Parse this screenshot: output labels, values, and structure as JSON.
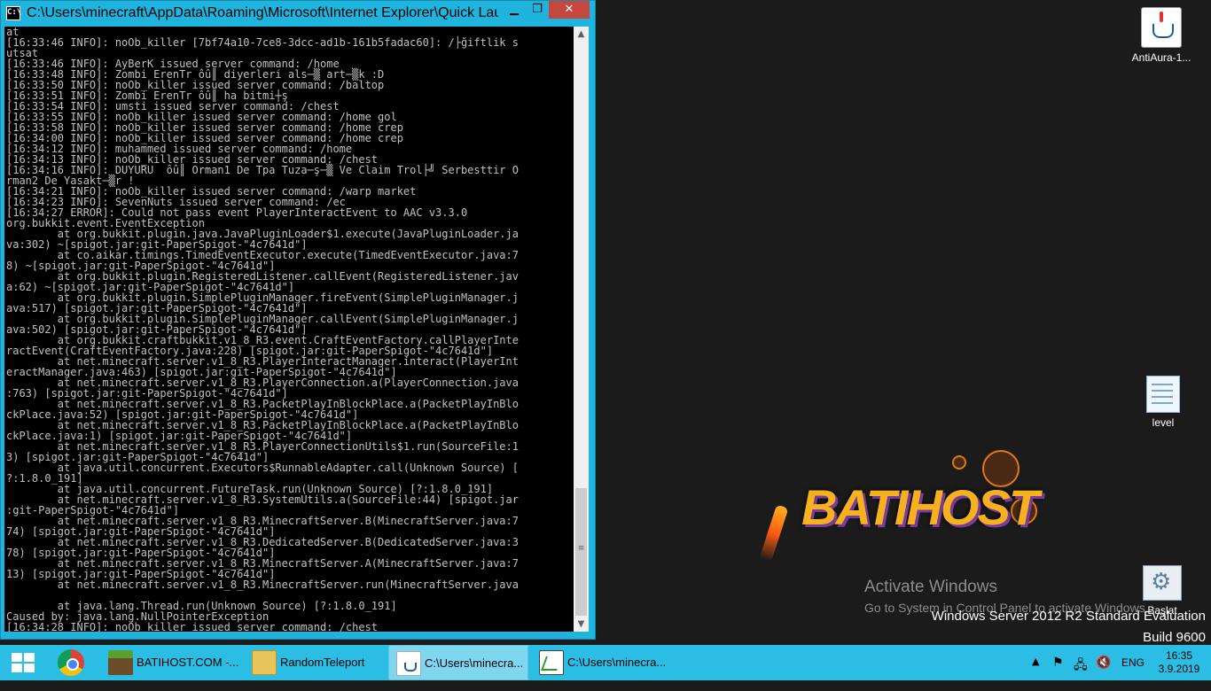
{
  "console": {
    "title": "C:\\Users\\minecraft\\AppData\\Roaming\\Microsoft\\Internet Explorer\\Quick Launc...",
    "controls": {
      "minimize": "▁",
      "maximize": "❐",
      "close": "✕"
    },
    "lines": [
      "at",
      "[16:33:46 INFO]: noOb_killer [7bf74a10-7ce8-3dcc-ad1b-161b5fadac60]: /├ğiftlik s",
      "utsat",
      "[16:33:46 INFO]: AyBerK issued server command: /home",
      "[16:33:48 INFO]: Zombi ErenTr ôû║ diyerleri als─▒ art─▒k :D",
      "[16:33:50 INFO]: noOb_killer issued server command: /baltop",
      "[16:33:51 INFO]: Zombi ErenTr ôû║ ha bitmi┼ş",
      "[16:33:54 INFO]: umsti issued server command: /chest",
      "[16:33:55 INFO]: noOb_killer issued server command: /home gol",
      "[16:33:58 INFO]: noOb_killer issued server command: /home crep",
      "[16:34:00 INFO]: noOb_killer issued server command: /home crep",
      "[16:34:12 INFO]: muhammed issued server command: /home",
      "[16:34:13 INFO]: noOb_killer issued server command: /chest",
      "[16:34:16 INFO]: DUYURU  ôû║ Orman1 De Tpa Tuza─ş─▒ Ve Claim Trol├╝ Serbesttir O",
      "rman2 De Yasakt─▒r !",
      "[16:34:21 INFO]: noOb_killer issued server command: /warp market",
      "[16:34:23 INFO]: SevenNuts issued server command: /ec",
      "[16:34:27 ERROR]: Could not pass event PlayerInteractEvent to AAC v3.3.0",
      "org.bukkit.event.EventException",
      "        at org.bukkit.plugin.java.JavaPluginLoader$1.execute(JavaPluginLoader.ja",
      "va:302) ~[spigot.jar:git-PaperSpigot-\"4c7641d\"]",
      "        at co.aikar.timings.TimedEventExecutor.execute(TimedEventExecutor.java:7",
      "8) ~[spigot.jar:git-PaperSpigot-\"4c7641d\"]",
      "        at org.bukkit.plugin.RegisteredListener.callEvent(RegisteredListener.jav",
      "a:62) ~[spigot.jar:git-PaperSpigot-\"4c7641d\"]",
      "        at org.bukkit.plugin.SimplePluginManager.fireEvent(SimplePluginManager.j",
      "ava:517) [spigot.jar:git-PaperSpigot-\"4c7641d\"]",
      "        at org.bukkit.plugin.SimplePluginManager.callEvent(SimplePluginManager.j",
      "ava:502) [spigot.jar:git-PaperSpigot-\"4c7641d\"]",
      "        at org.bukkit.craftbukkit.v1_8_R3.event.CraftEventFactory.callPlayerInte",
      "ractEvent(CraftEventFactory.java:228) [spigot.jar:git-PaperSpigot-\"4c7641d\"]",
      "        at net.minecraft.server.v1_8_R3.PlayerInteractManager.interact(PlayerInt",
      "eractManager.java:463) [spigot.jar:git-PaperSpigot-\"4c7641d\"]",
      "        at net.minecraft.server.v1_8_R3.PlayerConnection.a(PlayerConnection.java",
      ":763) [spigot.jar:git-PaperSpigot-\"4c7641d\"]",
      "        at net.minecraft.server.v1_8_R3.PacketPlayInBlockPlace.a(PacketPlayInBlo",
      "ckPlace.java:52) [spigot.jar:git-PaperSpigot-\"4c7641d\"]",
      "        at net.minecraft.server.v1_8_R3.PacketPlayInBlockPlace.a(PacketPlayInBlo",
      "ckPlace.java:1) [spigot.jar:git-PaperSpigot-\"4c7641d\"]",
      "        at net.minecraft.server.v1_8_R3.PlayerConnectionUtils$1.run(SourceFile:1",
      "3) [spigot.jar:git-PaperSpigot-\"4c7641d\"]",
      "        at java.util.concurrent.Executors$RunnableAdapter.call(Unknown Source) [",
      "?:1.8.0_191]",
      "        at java.util.concurrent.FutureTask.run(Unknown Source) [?:1.8.0_191]",
      "        at net.minecraft.server.v1_8_R3.SystemUtils.a(SourceFile:44) [spigot.jar",
      ":git-PaperSpigot-\"4c7641d\"]",
      "        at net.minecraft.server.v1_8_R3.MinecraftServer.B(MinecraftServer.java:7",
      "74) [spigot.jar:git-PaperSpigot-\"4c7641d\"]",
      "        at net.minecraft.server.v1_8_R3.DedicatedServer.B(DedicatedServer.java:3",
      "78) [spigot.jar:git-PaperSpigot-\"4c7641d\"]",
      "        at net.minecraft.server.v1_8_R3.MinecraftServer.A(MinecraftServer.java:7",
      "13) [spigot.jar:git-PaperSpigot-\"4c7641d\"]",
      "        at net.minecraft.server.v1_8_R3.MinecraftServer.run(MinecraftServer.java",
      "",
      "        at java.lang.Thread.run(Unknown Source) [?:1.8.0_191]",
      "Caused by: java.lang.NullPointerException",
      "[16:34:28 INFO]: noOb_killer issued server command: /chest"
    ]
  },
  "scrollbar": {
    "up": "▲",
    "down": "▼",
    "grip": "≡"
  },
  "desktop": {
    "icons": [
      {
        "label": "AntiAura-1...",
        "icon": "java-file-icon"
      },
      {
        "label": "level",
        "icon": "notepad-icon"
      },
      {
        "label": "Başlat",
        "icon": "control-panel-icon"
      }
    ],
    "logo_text": "BATIHOST",
    "watermark": {
      "title": "Activate Windows",
      "subtitle": "Go to System in Control Panel to activate Windows."
    },
    "edition": [
      "Windows Server 2012 R2 Standard Evaluation",
      "Build 9600"
    ]
  },
  "taskbar": {
    "tasks": [
      {
        "label": "BATIHOST.COM -...",
        "icon": "minecraft-icon"
      },
      {
        "label": "RandomTeleport",
        "icon": "folder-icon"
      },
      {
        "label": "C:\\Users\\minecra...",
        "icon": "java-icon"
      },
      {
        "label": "C:\\Users\\minecra...",
        "icon": "chart-icon"
      }
    ],
    "tray": {
      "show_hidden": "▲",
      "language": "ENG",
      "time": "16:35",
      "date": "3.9.2019"
    }
  },
  "colors": {
    "taskbar": "#2cbde4",
    "window_frame": "#1eb4de",
    "console_bg": "#000000",
    "console_text": "#c0c0c0",
    "desktop": "#1b1b1b"
  }
}
